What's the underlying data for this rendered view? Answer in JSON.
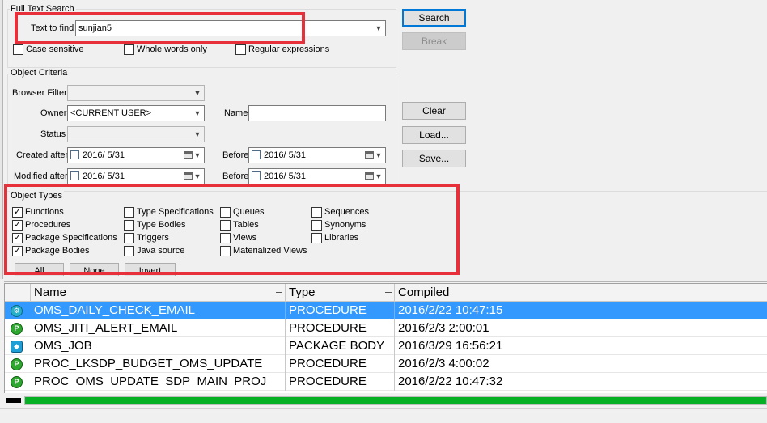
{
  "full_text_search": {
    "legend": "Full Text Search",
    "text_to_find_label": "Text to find",
    "text_to_find_value": "sunjian5",
    "case_sensitive": {
      "label": "Case sensitive",
      "checked": false
    },
    "whole_words_only": {
      "label": "Whole words only",
      "checked": false
    },
    "regular_expressions": {
      "label": "Regular expressions",
      "checked": false
    }
  },
  "buttons": {
    "search": "Search",
    "break": "Break",
    "clear": "Clear",
    "load": "Load...",
    "save": "Save..."
  },
  "object_criteria": {
    "legend": "Object Criteria",
    "browser_filter_label": "Browser Filter",
    "browser_filter_value": "",
    "owner_label": "Owner",
    "owner_value": "<CURRENT USER>",
    "name_label": "Name",
    "name_value": "",
    "status_label": "Status",
    "status_value": "",
    "created_after_label": "Created after",
    "created_after_value": "2016/  5/31",
    "created_before_label": "Before",
    "created_before_value": "2016/  5/31",
    "modified_after_label": "Modified after",
    "modified_after_value": "2016/  5/31",
    "modified_before_label": "Before",
    "modified_before_value": "2016/  5/31"
  },
  "object_types": {
    "legend": "Object Types",
    "items": [
      {
        "label": "Functions",
        "checked": true
      },
      {
        "label": "Procedures",
        "checked": true
      },
      {
        "label": "Package Specifications",
        "checked": true
      },
      {
        "label": "Package Bodies",
        "checked": true
      },
      {
        "label": "Type Specifications",
        "checked": false
      },
      {
        "label": "Type Bodies",
        "checked": false
      },
      {
        "label": "Triggers",
        "checked": false
      },
      {
        "label": "Java source",
        "checked": false
      },
      {
        "label": "Queues",
        "checked": false
      },
      {
        "label": "Tables",
        "checked": false
      },
      {
        "label": "Views",
        "checked": false
      },
      {
        "label": "Materialized Views",
        "checked": false
      },
      {
        "label": "Sequences",
        "checked": false
      },
      {
        "label": "Synonyms",
        "checked": false
      },
      {
        "label": "Libraries",
        "checked": false
      }
    ],
    "all_button": "All",
    "none_button": "None",
    "invert_button": "Invert"
  },
  "results": {
    "columns": [
      "Name",
      "Type",
      "Compiled"
    ],
    "rows": [
      {
        "name": "OMS_DAILY_CHECK_EMAIL",
        "type": "PROCEDURE",
        "compiled": "2016/2/22 10:47:15",
        "icon": "procedure-icon",
        "selected": true
      },
      {
        "name": "OMS_JITI_ALERT_EMAIL",
        "type": "PROCEDURE",
        "compiled": "2016/2/3 2:00:01",
        "icon": "procedure-icon",
        "selected": false
      },
      {
        "name": "OMS_JOB",
        "type": "PACKAGE BODY",
        "compiled": "2016/3/29 16:56:21",
        "icon": "package-body-icon",
        "selected": false
      },
      {
        "name": "PROC_LKSDP_BUDGET_OMS_UPDATE",
        "type": "PROCEDURE",
        "compiled": "2016/2/3 4:00:02",
        "icon": "procedure-icon",
        "selected": false
      },
      {
        "name": "PROC_OMS_UPDATE_SDP_MAIN_PROJ",
        "type": "PROCEDURE",
        "compiled": "2016/2/22 10:47:32",
        "icon": "procedure-icon",
        "selected": false
      }
    ]
  },
  "progress": {
    "fraction": 1.0,
    "color": "#06b025"
  },
  "colors": {
    "highlight": "#e8303a",
    "selection": "#3399ff"
  }
}
